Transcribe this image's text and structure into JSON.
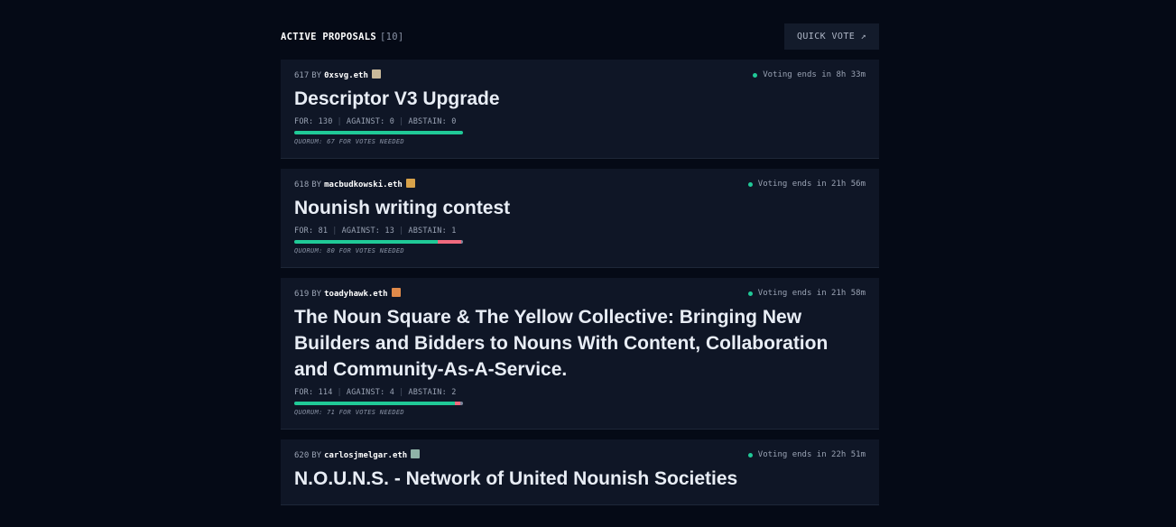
{
  "header": {
    "title": "ACTIVE PROPOSALS",
    "count": "[10]",
    "quick_vote_label": "QUICK VOTE ↗"
  },
  "colors": {
    "for": "#20c997",
    "against": "#f06a7e",
    "status_dot": "#20c997"
  },
  "proposals": [
    {
      "id": "617",
      "by": "BY",
      "author": "0xsvg.eth",
      "avatar_color": "#c9b99a",
      "status": "Voting ends in 8h 33m",
      "title": "Descriptor V3 Upgrade",
      "for_label": "FOR: 130",
      "against_label": "AGAINST: 0",
      "abstain_label": "ABSTAIN: 0",
      "for": 130,
      "against": 0,
      "abstain": 0,
      "quorum": "QUORUM: 67 FOR VOTES NEEDED"
    },
    {
      "id": "618",
      "by": "BY",
      "author": "macbudkowski.eth",
      "avatar_color": "#d8a24a",
      "status": "Voting ends in 21h 56m",
      "title": "Nounish writing contest",
      "for_label": "FOR: 81",
      "against_label": "AGAINST: 13",
      "abstain_label": "ABSTAIN: 1",
      "for": 81,
      "against": 13,
      "abstain": 1,
      "quorum": "QUORUM: 80 FOR VOTES NEEDED"
    },
    {
      "id": "619",
      "by": "BY",
      "author": "toadyhawk.eth",
      "avatar_color": "#e08a4a",
      "status": "Voting ends in 21h 58m",
      "title": "The Noun Square & The Yellow Collective: Bringing New Builders and Bidders to Nouns With Content, Collaboration and Community-As-A-Service.",
      "for_label": "FOR: 114",
      "against_label": "AGAINST: 4",
      "abstain_label": "ABSTAIN: 2",
      "for": 114,
      "against": 4,
      "abstain": 2,
      "quorum": "QUORUM: 71 FOR VOTES NEEDED"
    },
    {
      "id": "620",
      "by": "BY",
      "author": "carlosjmelgar.eth",
      "avatar_color": "#8fb3a8",
      "status": "Voting ends in 22h 51m",
      "title": "N.O.U.N.S. - Network of United Nounish Societies"
    }
  ]
}
